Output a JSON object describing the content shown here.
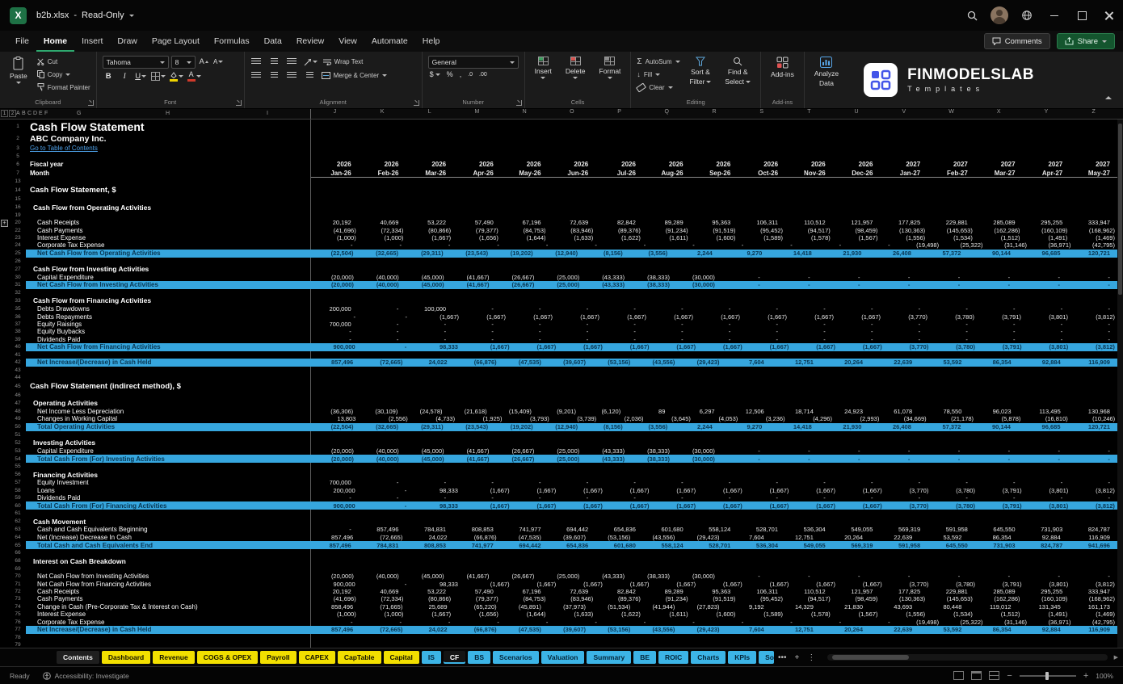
{
  "titlebar": {
    "filename": "b2b.xlsx",
    "separator": "-",
    "mode": "Read-Only"
  },
  "menubar": {
    "items": [
      "File",
      "Home",
      "Insert",
      "Draw",
      "Page Layout",
      "Formulas",
      "Data",
      "Review",
      "View",
      "Automate",
      "Help"
    ],
    "active_item": "Home",
    "comments_label": "Comments",
    "share_label": "Share"
  },
  "ribbon": {
    "paste": "Paste",
    "cut": "Cut",
    "copy": "Copy",
    "format_painter": "Format Painter",
    "clipboard_group": "Clipboard",
    "font_name": "Tahoma",
    "font_size": "8",
    "font_group": "Font",
    "wrap_text": "Wrap Text",
    "merge_center": "Merge & Center",
    "alignment_group": "Alignment",
    "number_format": "General",
    "number_group": "Number",
    "insert": "Insert",
    "delete": "Delete",
    "format": "Format",
    "cells_group": "Cells",
    "autosum": "AutoSum",
    "fill": "Fill",
    "clear": "Clear",
    "sort_filter_1": "Sort &",
    "sort_filter_2": "Filter",
    "find_select_1": "Find &",
    "find_select_2": "Select",
    "editing_group": "Editing",
    "addins": "Add-ins",
    "addins_group": "Add-ins",
    "analyze_1": "Analyze",
    "analyze_2": "Data",
    "logo_title": "FINMODELSLAB",
    "logo_subtitle": "Templates"
  },
  "sheet": {
    "outline_buttons": [
      "1",
      "2"
    ],
    "col_letters_left": [
      "A",
      "B",
      "C",
      "D",
      "E",
      "F",
      "G",
      "H",
      "I"
    ],
    "col_letters_data": [
      "J",
      "K",
      "L",
      "M",
      "N",
      "O",
      "P",
      "Q",
      "R",
      "S",
      "T",
      "U",
      "V",
      "W",
      "X",
      "Y",
      "Z"
    ],
    "series": {
      "years": [
        "2026",
        "2026",
        "2026",
        "2026",
        "2026",
        "2026",
        "2026",
        "2026",
        "2026",
        "2026",
        "2026",
        "2026",
        "2027",
        "2027",
        "2027",
        "2027",
        "2027"
      ],
      "months": [
        "Jan-26",
        "Feb-26",
        "Mar-26",
        "Apr-26",
        "May-26",
        "Jun-26",
        "Jul-26",
        "Aug-26",
        "Sep-26",
        "Oct-26",
        "Nov-26",
        "Dec-26",
        "Jan-27",
        "Feb-27",
        "Mar-27",
        "Apr-27",
        "May-27"
      ],
      "cash_receipts": [
        "20,192",
        "40,669",
        "53,222",
        "57,490",
        "67,196",
        "72,639",
        "82,842",
        "89,289",
        "95,363",
        "106,311",
        "110,512",
        "121,957",
        "177,825",
        "229,881",
        "285,089",
        "295,255",
        "333,947"
      ],
      "cash_payments": [
        "(41,696)",
        "(72,334)",
        "(80,866)",
        "(79,377)",
        "(84,753)",
        "(83,946)",
        "(89,376)",
        "(91,234)",
        "(91,519)",
        "(95,452)",
        "(94,517)",
        "(98,459)",
        "(130,363)",
        "(145,653)",
        "(162,286)",
        "(160,109)",
        "(168,962)"
      ],
      "interest_expense": [
        "(1,000)",
        "(1,000)",
        "(1,667)",
        "(1,656)",
        "(1,644)",
        "(1,633)",
        "(1,622)",
        "(1,611)",
        "(1,600)",
        "(1,589)",
        "(1,578)",
        "(1,567)",
        "(1,556)",
        "(1,534)",
        "(1,512)",
        "(1,491)",
        "(1,469)"
      ],
      "corporate_tax": [
        "-",
        "-",
        "-",
        "-",
        "-",
        "-",
        "-",
        "-",
        "-",
        "-",
        "-",
        "-",
        "(19,498)",
        "(25,322)",
        "(31,146)",
        "(36,971)",
        "(42,795)"
      ],
      "net_operating": [
        "(22,504)",
        "(32,665)",
        "(29,311)",
        "(23,543)",
        "(19,202)",
        "(12,940)",
        "(8,156)",
        "(3,556)",
        "2,244",
        "9,270",
        "14,418",
        "21,930",
        "26,408",
        "57,372",
        "90,144",
        "96,685",
        "120,721"
      ],
      "capex": [
        "(20,000)",
        "(40,000)",
        "(45,000)",
        "(41,667)",
        "(26,667)",
        "(25,000)",
        "(43,333)",
        "(38,333)",
        "(30,000)",
        "-",
        "-",
        "-",
        "-",
        "-",
        "-",
        "-",
        "-"
      ],
      "debts_drawdowns": [
        "200,000",
        "-",
        "100,000",
        "-",
        "-",
        "-",
        "-",
        "-",
        "-",
        "-",
        "-",
        "-",
        "-",
        "-",
        "-",
        "-",
        "-"
      ],
      "debts_repayments": [
        "-",
        "-",
        "(1,667)",
        "(1,667)",
        "(1,667)",
        "(1,667)",
        "(1,667)",
        "(1,667)",
        "(1,667)",
        "(1,667)",
        "(1,667)",
        "(1,667)",
        "(3,770)",
        "(3,780)",
        "(3,791)",
        "(3,801)",
        "(3,812)"
      ],
      "equity_raisings": [
        "700,000",
        "-",
        "-",
        "-",
        "-",
        "-",
        "-",
        "-",
        "-",
        "-",
        "-",
        "-",
        "-",
        "-",
        "-",
        "-",
        "-"
      ],
      "dashes": [
        "-",
        "-",
        "-",
        "-",
        "-",
        "-",
        "-",
        "-",
        "-",
        "-",
        "-",
        "-",
        "-",
        "-",
        "-",
        "-",
        "-"
      ],
      "net_financing": [
        "900,000",
        "-",
        "98,333",
        "(1,667)",
        "(1,667)",
        "(1,667)",
        "(1,667)",
        "(1,667)",
        "(1,667)",
        "(1,667)",
        "(1,667)",
        "(1,667)",
        "(3,770)",
        "(3,780)",
        "(3,791)",
        "(3,801)",
        "(3,812)"
      ],
      "net_increase": [
        "857,496",
        "(72,665)",
        "24,022",
        "(66,876)",
        "(47,535)",
        "(39,607)",
        "(53,156)",
        "(43,556)",
        "(29,423)",
        "7,604",
        "12,751",
        "20,264",
        "22,639",
        "53,592",
        "86,354",
        "92,884",
        "116,909"
      ],
      "net_income_less_dep": [
        "(36,306)",
        "(30,109)",
        "(24,578)",
        "(21,618)",
        "(15,409)",
        "(9,201)",
        "(6,120)",
        "89",
        "6,297",
        "12,506",
        "18,714",
        "24,923",
        "61,078",
        "78,550",
        "96,023",
        "113,495",
        "130,968"
      ],
      "changes_wc": [
        "13,803",
        "(2,556)",
        "(4,733)",
        "(1,925)",
        "(3,793)",
        "(3,739)",
        "(2,036)",
        "(3,645)",
        "(4,053)",
        "(3,236)",
        "(4,296)",
        "(2,993)",
        "(34,669)",
        "(21,178)",
        "(5,878)",
        "(16,810)",
        "(10,246)"
      ],
      "equity_investment": [
        "700,000",
        "-",
        "-",
        "-",
        "-",
        "-",
        "-",
        "-",
        "-",
        "-",
        "-",
        "-",
        "-",
        "-",
        "-",
        "-",
        "-"
      ],
      "loans": [
        "200,000",
        "-",
        "98,333",
        "(1,667)",
        "(1,667)",
        "(1,667)",
        "(1,667)",
        "(1,667)",
        "(1,667)",
        "(1,667)",
        "(1,667)",
        "(1,667)",
        "(3,770)",
        "(3,780)",
        "(3,791)",
        "(3,801)",
        "(3,812)"
      ],
      "cash_beginning": [
        "-",
        "857,496",
        "784,831",
        "808,853",
        "741,977",
        "694,442",
        "654,836",
        "601,680",
        "558,124",
        "528,701",
        "536,304",
        "549,055",
        "569,319",
        "591,958",
        "645,550",
        "731,903",
        "824,787"
      ],
      "cash_end": [
        "857,496",
        "784,831",
        "808,853",
        "741,977",
        "694,442",
        "654,836",
        "601,680",
        "558,124",
        "528,701",
        "536,304",
        "549,055",
        "569,319",
        "591,958",
        "645,550",
        "731,903",
        "824,787",
        "941,696"
      ],
      "change_pre_tax": [
        "858,496",
        "(71,665)",
        "25,689",
        "(65,220)",
        "(45,891)",
        "(37,973)",
        "(51,534)",
        "(41,944)",
        "(27,823)",
        "9,192",
        "14,329",
        "21,830",
        "43,693",
        "80,448",
        "119,012",
        "131,345",
        "161,173"
      ]
    },
    "rows": [
      {
        "n": "1",
        "t": "h1",
        "l": "Cash Flow Statement"
      },
      {
        "n": "2",
        "t": "h2",
        "l": "ABC Company Inc."
      },
      {
        "n": "3",
        "t": "link",
        "l": "Go to Table of Contents"
      },
      {
        "n": "5",
        "t": "blank"
      },
      {
        "n": "6",
        "t": "fy",
        "l": "Fiscal year",
        "r": "years"
      },
      {
        "n": "7",
        "t": "mo",
        "l": "Month",
        "r": "months"
      },
      {
        "n": "13",
        "t": "blank"
      },
      {
        "n": "14",
        "t": "sect",
        "l": "Cash Flow Statement, $"
      },
      {
        "n": "15",
        "t": "blank"
      },
      {
        "n": "16",
        "t": "sub",
        "l": "Cash Flow from Operating Activities"
      },
      {
        "n": "19",
        "t": "blank"
      },
      {
        "n": "20",
        "t": "data",
        "l": "Cash Receipts",
        "r": "cash_receipts"
      },
      {
        "n": "22",
        "t": "data",
        "l": "Cash Payments",
        "r": "cash_payments"
      },
      {
        "n": "23",
        "t": "data",
        "l": "Interest Expense",
        "r": "interest_expense"
      },
      {
        "n": "24",
        "t": "data",
        "l": "Corporate Tax Expense",
        "r": "corporate_tax"
      },
      {
        "n": "25",
        "t": "total",
        "l": "Net Cash Flow from Operating Activities",
        "r": "net_operating"
      },
      {
        "n": "26",
        "t": "blank"
      },
      {
        "n": "27",
        "t": "sub",
        "l": "Cash Flow from Investing Activities"
      },
      {
        "n": "30",
        "t": "data",
        "l": "Capital Expenditure",
        "r": "capex"
      },
      {
        "n": "31",
        "t": "total",
        "l": "Net Cash Flow from Investing Activities",
        "r": "capex"
      },
      {
        "n": "32",
        "t": "blank"
      },
      {
        "n": "33",
        "t": "sub",
        "l": "Cash Flow from Financing Activities"
      },
      {
        "n": "35",
        "t": "data",
        "l": "Debts Drawdowns",
        "r": "debts_drawdowns"
      },
      {
        "n": "36",
        "t": "data",
        "l": "Debts Repayments",
        "r": "debts_repayments"
      },
      {
        "n": "37",
        "t": "data",
        "l": "Equity Raisings",
        "r": "equity_raisings"
      },
      {
        "n": "38",
        "t": "data",
        "l": "Equity Buybacks",
        "r": "dashes"
      },
      {
        "n": "39",
        "t": "data",
        "l": "Dividends Paid",
        "r": "dashes"
      },
      {
        "n": "40",
        "t": "total",
        "l": "Net Cash Flow from Financing Activities",
        "r": "net_financing"
      },
      {
        "n": "41",
        "t": "blank"
      },
      {
        "n": "42",
        "t": "total",
        "l": "Net Increase/(Decrease) in Cash Held",
        "r": "net_increase"
      },
      {
        "n": "43",
        "t": "blank"
      },
      {
        "n": "44",
        "t": "blank"
      },
      {
        "n": "45",
        "t": "sect",
        "l": "Cash Flow Statement (indirect method), $"
      },
      {
        "n": "46",
        "t": "blank"
      },
      {
        "n": "47",
        "t": "sub",
        "l": "Operating Activities"
      },
      {
        "n": "48",
        "t": "data",
        "l": "Net Income Less Depreciation",
        "r": "net_income_less_dep"
      },
      {
        "n": "49",
        "t": "data",
        "l": "Changes in Working Capital",
        "r": "changes_wc"
      },
      {
        "n": "50",
        "t": "total",
        "l": "Total Operating Activities",
        "r": "net_operating"
      },
      {
        "n": "51",
        "t": "blank"
      },
      {
        "n": "52",
        "t": "sub",
        "l": "Investing Activities"
      },
      {
        "n": "53",
        "t": "data",
        "l": "Capital Expenditure",
        "r": "capex"
      },
      {
        "n": "54",
        "t": "total",
        "l": "Total Cash From (For) Investing Activities",
        "r": "capex"
      },
      {
        "n": "55",
        "t": "blank"
      },
      {
        "n": "56",
        "t": "sub",
        "l": "Financing Activities"
      },
      {
        "n": "57",
        "t": "data",
        "l": "Equity Investment",
        "r": "equity_investment"
      },
      {
        "n": "58",
        "t": "data",
        "l": "Loans",
        "r": "loans"
      },
      {
        "n": "59",
        "t": "data",
        "l": "Dividends Paid",
        "r": "dashes"
      },
      {
        "n": "60",
        "t": "total",
        "l": "Total Cash From (For) Financing Activities",
        "r": "net_financing"
      },
      {
        "n": "61",
        "t": "blank"
      },
      {
        "n": "62",
        "t": "sub",
        "l": "Cash Movement"
      },
      {
        "n": "63",
        "t": "data",
        "l": "Cash and Cash Equivalents Beginning",
        "r": "cash_beginning"
      },
      {
        "n": "64",
        "t": "data",
        "l": "Net (Increase) Decrease In Cash",
        "r": "net_increase"
      },
      {
        "n": "65",
        "t": "total",
        "l": "Total Cash and Cash Equivalents End",
        "r": "cash_end"
      },
      {
        "n": "66",
        "t": "blank"
      },
      {
        "n": "68",
        "t": "sub",
        "l": "Interest on Cash Breakdown"
      },
      {
        "n": "69",
        "t": "blank"
      },
      {
        "n": "70",
        "t": "data",
        "l": "Net Cash Flow from Investing Activities",
        "r": "capex"
      },
      {
        "n": "71",
        "t": "data",
        "l": "Net Cash Flow from Financing Activities",
        "r": "net_financing"
      },
      {
        "n": "72",
        "t": "data",
        "l": "Cash Receipts",
        "r": "cash_receipts"
      },
      {
        "n": "73",
        "t": "data",
        "l": "Cash Payments",
        "r": "cash_payments"
      },
      {
        "n": "74",
        "t": "data",
        "l": "Change in Cash (Pre-Corporate Tax & Interest on Cash)",
        "r": "change_pre_tax"
      },
      {
        "n": "75",
        "t": "data",
        "l": "Interest Expense",
        "r": "interest_expense"
      },
      {
        "n": "76",
        "t": "data",
        "l": "Corporate Tax Expense",
        "r": "corporate_tax"
      },
      {
        "n": "77",
        "t": "total",
        "l": "Net Increase/(Decrease) in Cash Held",
        "r": "net_increase"
      },
      {
        "n": "78",
        "t": "blank"
      },
      {
        "n": "79",
        "t": "blank"
      }
    ]
  },
  "tabs": {
    "items": [
      {
        "label": "Contents",
        "color": "none"
      },
      {
        "label": "Dashboard",
        "color": "yellow"
      },
      {
        "label": "Revenue",
        "color": "yellow"
      },
      {
        "label": "COGS & OPEX",
        "color": "yellow"
      },
      {
        "label": "Payroll",
        "color": "yellow"
      },
      {
        "label": "CAPEX",
        "color": "yellow"
      },
      {
        "label": "CapTable",
        "color": "yellow"
      },
      {
        "label": "Capital",
        "color": "yellow"
      },
      {
        "label": "IS",
        "color": "blue"
      },
      {
        "label": "CF",
        "color": "blue",
        "active": true
      },
      {
        "label": "BS",
        "color": "blue"
      },
      {
        "label": "Scenarios",
        "color": "blue"
      },
      {
        "label": "Valuation",
        "color": "blue"
      },
      {
        "label": "Summary",
        "color": "blue"
      },
      {
        "label": "BE",
        "color": "blue"
      },
      {
        "label": "ROIC",
        "color": "blue"
      },
      {
        "label": "Charts",
        "color": "blue"
      },
      {
        "label": "KPIs",
        "color": "blue"
      },
      {
        "label": "So",
        "color": "blue",
        "partial": true
      }
    ],
    "more_label": "•••",
    "add_label": "+",
    "menu_label": "⋮"
  },
  "statusbar": {
    "ready": "Ready",
    "accessibility": "Accessibility: Investigate",
    "zoom": "100%"
  }
}
